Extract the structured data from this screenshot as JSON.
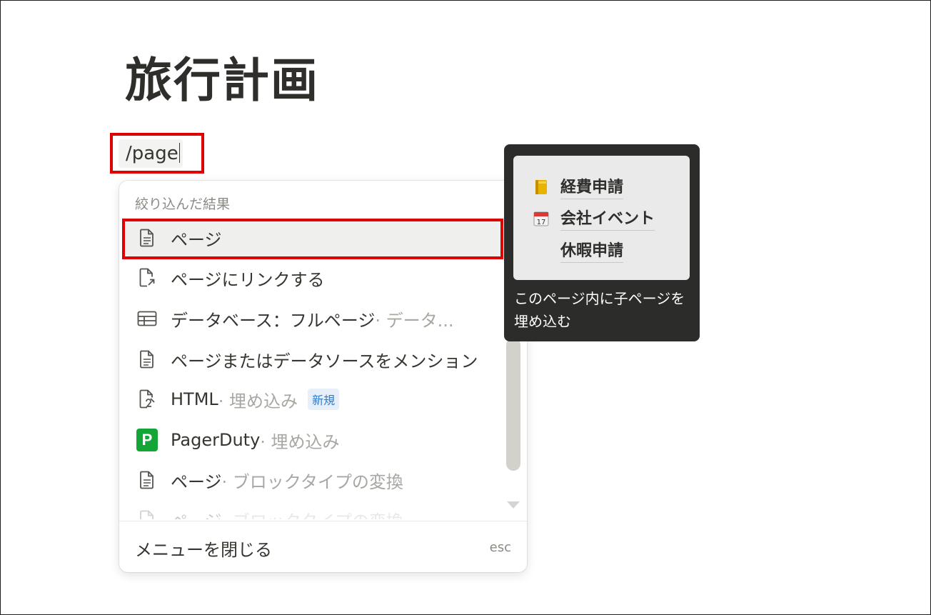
{
  "page": {
    "title": "旅行計画"
  },
  "editor": {
    "command_text": "/page"
  },
  "menu": {
    "section_label": "絞り込んだ結果",
    "items": [
      {
        "label": "ページ",
        "sub": "",
        "icon": "page-icon"
      },
      {
        "label": "ページにリンクする",
        "sub": "",
        "icon": "page-link-icon"
      },
      {
        "label": "データベース：フルページ",
        "sub": " · データ...",
        "icon": "table-icon"
      },
      {
        "label": "ページまたはデータソースをメンション",
        "sub": "",
        "icon": "page-icon"
      },
      {
        "label": "HTML",
        "sub": " · 埋め込み",
        "badge": "新規",
        "icon": "html-embed-icon"
      },
      {
        "label": "PagerDuty",
        "sub": " · 埋め込み",
        "icon": "pagerduty-logo",
        "logo_letter": "P"
      },
      {
        "label": "ページ",
        "sub": " · ブロックタイプの変換",
        "icon": "page-icon"
      },
      {
        "label": "ページ",
        "sub": " · ブロックタイプの変換",
        "icon": "page-icon"
      }
    ],
    "footer": {
      "close_label": "メニューを閉じる",
      "shortcut": "esc"
    }
  },
  "tooltip": {
    "preview_items": [
      {
        "label": "経費申請",
        "icon": "ledger-icon"
      },
      {
        "label": "会社イベント",
        "icon": "calendar-icon"
      },
      {
        "label": "休暇申請",
        "icon": ""
      }
    ],
    "description": "このページ内に子ページを埋め込む"
  },
  "colors": {
    "highlight": "#e00000",
    "pagerduty": "#13a637",
    "badge_text": "#2f7bd0"
  }
}
